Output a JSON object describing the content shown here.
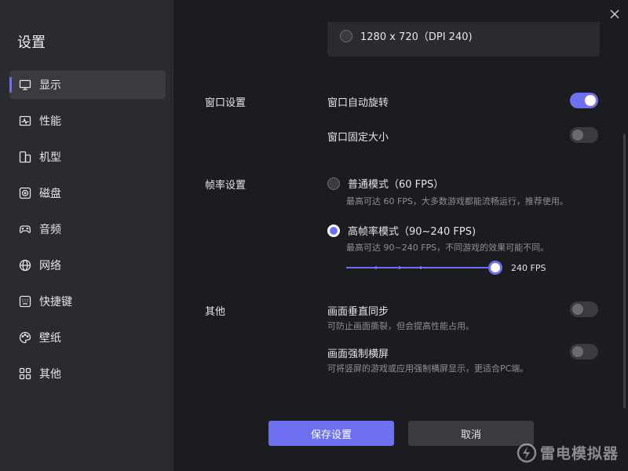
{
  "window": {
    "title": "设置"
  },
  "sidebar": {
    "items": [
      {
        "label": "显示",
        "icon": "monitor-icon",
        "active": true
      },
      {
        "label": "性能",
        "icon": "performance-icon",
        "active": false
      },
      {
        "label": "机型",
        "icon": "device-model-icon",
        "active": false
      },
      {
        "label": "磁盘",
        "icon": "disk-icon",
        "active": false
      },
      {
        "label": "音频",
        "icon": "gamepad-icon",
        "active": false
      },
      {
        "label": "网络",
        "icon": "globe-icon",
        "active": false
      },
      {
        "label": "快捷键",
        "icon": "keyboard-icon",
        "active": false
      },
      {
        "label": "壁纸",
        "icon": "palette-icon",
        "active": false
      },
      {
        "label": "其他",
        "icon": "grid-icon",
        "active": false
      }
    ]
  },
  "resolution": {
    "option_label": "1280 x 720（DPI 240)",
    "selected": false
  },
  "window_settings": {
    "section_label": "窗口设置",
    "auto_rotate": {
      "label": "窗口自动旋转",
      "enabled": true
    },
    "fixed_size": {
      "label": "窗口固定大小",
      "enabled": false
    }
  },
  "frame_rate": {
    "section_label": "帧率设置",
    "normal": {
      "label": "普通模式（60 FPS）",
      "desc": "最高可达 60 FPS，大多数游戏都能流畅运行，推荐使用。",
      "selected": false
    },
    "high": {
      "label": "高帧率模式（90~240 FPS)",
      "desc": "最高可达 90~240 FPS，不同游戏的效果可能不同。",
      "selected": true
    },
    "slider": {
      "min": 90,
      "max": 240,
      "value": 240,
      "value_label": "240 FPS",
      "steps": [
        90,
        120,
        144,
        165,
        240
      ]
    }
  },
  "other": {
    "section_label": "其他",
    "vsync": {
      "label": "画面垂直同步",
      "desc": "可防止画面撕裂，但会提高性能占用。",
      "enabled": false
    },
    "force_landscape": {
      "label": "画面强制横屏",
      "desc": "可将竖屏的游戏或应用强制横屏显示，更适合PC端。",
      "enabled": false
    }
  },
  "buttons": {
    "save": "保存设置",
    "cancel": "取消"
  },
  "watermark": {
    "text": "雷电模拟器"
  },
  "colors": {
    "accent": "#6f70f0",
    "sidebar_bg": "#2a2b30",
    "main_bg": "#1b1c20"
  }
}
